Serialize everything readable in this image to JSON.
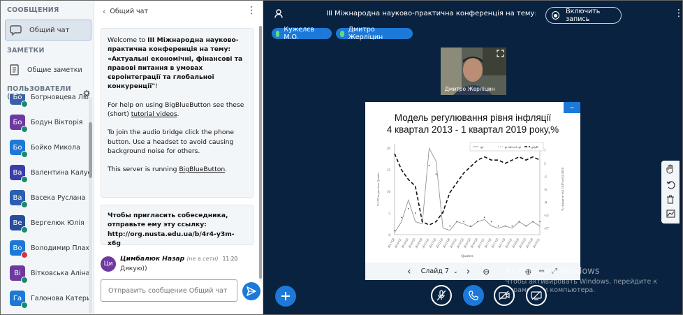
{
  "sidebar": {
    "messages_title": "СООБЩЕНИЯ",
    "chat_item": "Общий чат",
    "notes_title": "ЗАМЕТКИ",
    "notes_item": "Общие заметки",
    "users_title": "ПОЛЬЗОВАТЕЛИ (71)",
    "users": [
      {
        "initials": "Бо",
        "name": "Богрновцева Лю...",
        "color": "#3a5fa8",
        "muted": false
      },
      {
        "initials": "Бо",
        "name": "Бодун Вікторія",
        "color": "#6e3aa0",
        "muted": false
      },
      {
        "initials": "Бо",
        "name": "Бойко Микола",
        "color": "#1d79d8",
        "muted": false
      },
      {
        "initials": "Ва",
        "name": "Валентина Калус...",
        "color": "#3a3fa8",
        "muted": false
      },
      {
        "initials": "Ва",
        "name": "Васека Руслана",
        "color": "#2b5fb0",
        "muted": false
      },
      {
        "initials": "Ве",
        "name": "Вергелюк Юлія",
        "color": "#284d9e",
        "muted": false
      },
      {
        "initials": "Во",
        "name": "Володимир Плах...",
        "color": "#1d79d8",
        "muted": true
      },
      {
        "initials": "Ві",
        "name": "Вітковська Аліна",
        "color": "#6e3aa0",
        "muted": false
      },
      {
        "initials": "Га",
        "name": "Галонова Катерина",
        "color": "#1d79d8",
        "muted": false
      }
    ]
  },
  "chat": {
    "title": "Общий чат",
    "welcome_intro": "Welcome to ",
    "welcome_bold": "III Міжнародна науково-практична конференція на тему: «Актуальні економічні, фінансові та правові питання в умовах євроінтеграції та глобальної конкуренції\"",
    "welcome_end": "!",
    "help_pre": "For help on using BigBlueButton see these (short) ",
    "help_link": "tutorial videos",
    "help_post": ".",
    "audio_text": "To join the audio bridge click the phone button. Use a headset to avoid causing background noise for others.",
    "server_pre": "This server is running ",
    "server_link": "BigBlueButton",
    "server_post": ".",
    "invite_text": "Чтобы пригласить собеседника, отправьте ему эту ссылку:",
    "invite_link": "http://org.nusta.edu.ua/b/4r4-y3m-x6g",
    "message": {
      "initials": "Ци",
      "author": "Цимбалюк Назар",
      "status": "(не в сети)",
      "time": "11:20",
      "text": "Дякую))"
    },
    "input_placeholder": "Отправить сообщение Общий чат"
  },
  "main": {
    "meeting_title": "III Міжнародна науково-практична конференція на тему: «Акту...",
    "record_label": "Включить запись",
    "talkers": [
      "Кужелєв М.О.",
      "Дмитро Жерліцин"
    ],
    "webcam_label": "Дмитро Жерліцин",
    "slide_label": "Слайд 7",
    "watermark_title": "Активация Windows",
    "watermark_text": "Чтобы активировать Windows, перейдите к параметрам компьютера."
  },
  "chart_data": {
    "type": "line",
    "title_line1": "Модель регулювання рівня інфляції",
    "title_line2": "4 квартал 2013 - 1 квартал 2019 року,%",
    "legend": [
      "cpi",
      "predicted cpi",
      "gdpR"
    ],
    "xlabel": "Quarters",
    "ylabel": "% CPI to previous Quarter",
    "y2label": "% change of real GDP to Q4 2010",
    "categories": [
      "2013 Q4",
      "2014 Q1",
      "2014 Q2",
      "2014 Q3",
      "2014 Q4",
      "2015 Q1",
      "2015 Q2",
      "2015 Q3",
      "2015 Q4",
      "2016 Q1",
      "2016 Q2",
      "2016 Q3",
      "2016 Q4",
      "2017 Q1",
      "2017 Q2",
      "2017 Q3",
      "2017 Q4",
      "2018 Q1",
      "2018 Q2",
      "2018 Q3",
      "2018 Q4",
      "2019 Q1"
    ],
    "yticks": [
      "0",
      "5",
      "10",
      "15",
      "20"
    ],
    "y2ticks": [
      "7",
      "3",
      "-1",
      "-5",
      "-9",
      "-13",
      "-17"
    ],
    "ylim": [
      0,
      21
    ],
    "y2lim": [
      -19,
      9
    ],
    "series": [
      {
        "name": "cpi",
        "axis": "left",
        "values": [
          0.5,
          3,
          8,
          3,
          2.5,
          20,
          17,
          1.5,
          1,
          3,
          2.5,
          1.8,
          3,
          3.5,
          2,
          1.5,
          2,
          1.5,
          3,
          2,
          3,
          2
        ]
      },
      {
        "name": "predicted cpi",
        "axis": "left",
        "values": [
          1,
          4,
          6,
          5,
          3,
          16,
          14,
          5,
          2,
          3,
          3,
          2,
          3,
          4,
          3,
          2,
          2,
          2,
          3,
          2,
          3,
          3
        ]
      },
      {
        "name": "gdpR",
        "axis": "right",
        "values": [
          6,
          1,
          -2,
          -4,
          -15,
          -16,
          -15,
          -12,
          -6,
          -3,
          0,
          2,
          4,
          5,
          4,
          4,
          3,
          4,
          5,
          4,
          5,
          4
        ]
      }
    ]
  },
  "colors": {
    "main_bg": "#08223f",
    "accent": "#1d79d8",
    "danger": "#d9333f"
  }
}
